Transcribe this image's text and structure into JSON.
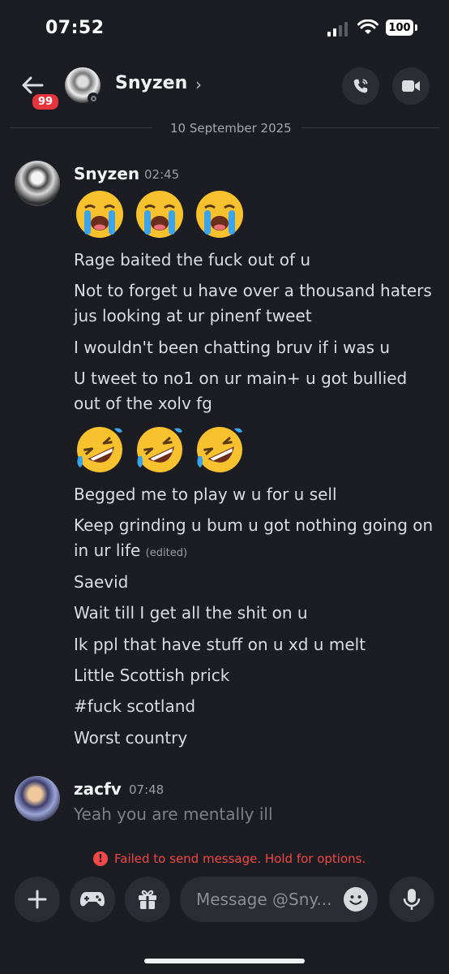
{
  "status_bar": {
    "time": "07:52",
    "battery": "100"
  },
  "header": {
    "unread_badge": "99",
    "contact_name": "Snyzen",
    "chevron": "›"
  },
  "date_divider": "10 September 2025",
  "messages": [
    {
      "author": "Snyzen",
      "time": "02:45",
      "emoji_row_1": [
        "loudly-crying-face",
        "loudly-crying-face",
        "loudly-crying-face"
      ],
      "lines": [
        "Rage baited the fuck out of u",
        "Not to forget u have over a thousand haters jus looking at ur pinenf tweet",
        "I wouldn't been chatting bruv if i was u",
        "U tweet to no1 on ur main+ u got bullied out of the xolv fg"
      ],
      "emoji_row_2": [
        "rolling-on-floor-laughing",
        "rolling-on-floor-laughing",
        "rolling-on-floor-laughing"
      ],
      "lines_2": [
        "Begged me to play w u for u sell",
        "Keep grinding u bum u got nothing going on in ur life",
        "Saevid",
        "Wait till I get all the shit on u",
        "Ik ppl that have stuff on u xd u melt",
        "Little Scottish prick",
        "#fuck scotland",
        "Worst country"
      ],
      "edited_label": "(edited)"
    },
    {
      "author": "zacfv",
      "time": "07:48",
      "text": "Yeah you are mentally ill"
    }
  ],
  "failed_notice": "Failed to send message. Hold for options.",
  "composer": {
    "placeholder": "Message @Sny..."
  }
}
